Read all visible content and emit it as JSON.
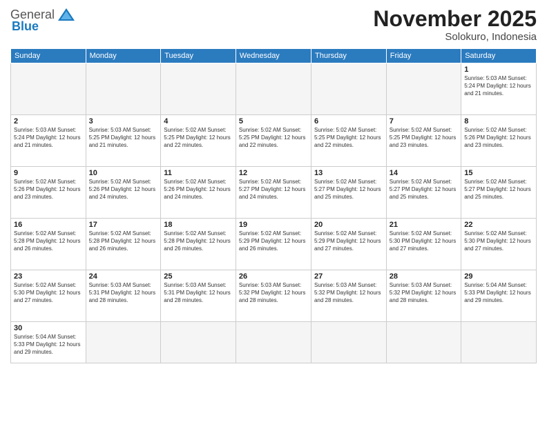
{
  "header": {
    "logo_general": "General",
    "logo_blue": "Blue",
    "month_year": "November 2025",
    "location": "Solokuro, Indonesia"
  },
  "weekdays": [
    "Sunday",
    "Monday",
    "Tuesday",
    "Wednesday",
    "Thursday",
    "Friday",
    "Saturday"
  ],
  "rows": [
    [
      {
        "date": "",
        "info": ""
      },
      {
        "date": "",
        "info": ""
      },
      {
        "date": "",
        "info": ""
      },
      {
        "date": "",
        "info": ""
      },
      {
        "date": "",
        "info": ""
      },
      {
        "date": "",
        "info": ""
      },
      {
        "date": "1",
        "info": "Sunrise: 5:03 AM\nSunset: 5:24 PM\nDaylight: 12 hours\nand 21 minutes."
      }
    ],
    [
      {
        "date": "2",
        "info": "Sunrise: 5:03 AM\nSunset: 5:24 PM\nDaylight: 12 hours\nand 21 minutes."
      },
      {
        "date": "3",
        "info": "Sunrise: 5:03 AM\nSunset: 5:25 PM\nDaylight: 12 hours\nand 21 minutes."
      },
      {
        "date": "4",
        "info": "Sunrise: 5:02 AM\nSunset: 5:25 PM\nDaylight: 12 hours\nand 22 minutes."
      },
      {
        "date": "5",
        "info": "Sunrise: 5:02 AM\nSunset: 5:25 PM\nDaylight: 12 hours\nand 22 minutes."
      },
      {
        "date": "6",
        "info": "Sunrise: 5:02 AM\nSunset: 5:25 PM\nDaylight: 12 hours\nand 22 minutes."
      },
      {
        "date": "7",
        "info": "Sunrise: 5:02 AM\nSunset: 5:25 PM\nDaylight: 12 hours\nand 23 minutes."
      },
      {
        "date": "8",
        "info": "Sunrise: 5:02 AM\nSunset: 5:26 PM\nDaylight: 12 hours\nand 23 minutes."
      }
    ],
    [
      {
        "date": "9",
        "info": "Sunrise: 5:02 AM\nSunset: 5:26 PM\nDaylight: 12 hours\nand 23 minutes."
      },
      {
        "date": "10",
        "info": "Sunrise: 5:02 AM\nSunset: 5:26 PM\nDaylight: 12 hours\nand 24 minutes."
      },
      {
        "date": "11",
        "info": "Sunrise: 5:02 AM\nSunset: 5:26 PM\nDaylight: 12 hours\nand 24 minutes."
      },
      {
        "date": "12",
        "info": "Sunrise: 5:02 AM\nSunset: 5:27 PM\nDaylight: 12 hours\nand 24 minutes."
      },
      {
        "date": "13",
        "info": "Sunrise: 5:02 AM\nSunset: 5:27 PM\nDaylight: 12 hours\nand 25 minutes."
      },
      {
        "date": "14",
        "info": "Sunrise: 5:02 AM\nSunset: 5:27 PM\nDaylight: 12 hours\nand 25 minutes."
      },
      {
        "date": "15",
        "info": "Sunrise: 5:02 AM\nSunset: 5:27 PM\nDaylight: 12 hours\nand 25 minutes."
      }
    ],
    [
      {
        "date": "16",
        "info": "Sunrise: 5:02 AM\nSunset: 5:28 PM\nDaylight: 12 hours\nand 26 minutes."
      },
      {
        "date": "17",
        "info": "Sunrise: 5:02 AM\nSunset: 5:28 PM\nDaylight: 12 hours\nand 26 minutes."
      },
      {
        "date": "18",
        "info": "Sunrise: 5:02 AM\nSunset: 5:28 PM\nDaylight: 12 hours\nand 26 minutes."
      },
      {
        "date": "19",
        "info": "Sunrise: 5:02 AM\nSunset: 5:29 PM\nDaylight: 12 hours\nand 26 minutes."
      },
      {
        "date": "20",
        "info": "Sunrise: 5:02 AM\nSunset: 5:29 PM\nDaylight: 12 hours\nand 27 minutes."
      },
      {
        "date": "21",
        "info": "Sunrise: 5:02 AM\nSunset: 5:30 PM\nDaylight: 12 hours\nand 27 minutes."
      },
      {
        "date": "22",
        "info": "Sunrise: 5:02 AM\nSunset: 5:30 PM\nDaylight: 12 hours\nand 27 minutes."
      }
    ],
    [
      {
        "date": "23",
        "info": "Sunrise: 5:02 AM\nSunset: 5:30 PM\nDaylight: 12 hours\nand 27 minutes."
      },
      {
        "date": "24",
        "info": "Sunrise: 5:03 AM\nSunset: 5:31 PM\nDaylight: 12 hours\nand 28 minutes."
      },
      {
        "date": "25",
        "info": "Sunrise: 5:03 AM\nSunset: 5:31 PM\nDaylight: 12 hours\nand 28 minutes."
      },
      {
        "date": "26",
        "info": "Sunrise: 5:03 AM\nSunset: 5:32 PM\nDaylight: 12 hours\nand 28 minutes."
      },
      {
        "date": "27",
        "info": "Sunrise: 5:03 AM\nSunset: 5:32 PM\nDaylight: 12 hours\nand 28 minutes."
      },
      {
        "date": "28",
        "info": "Sunrise: 5:03 AM\nSunset: 5:32 PM\nDaylight: 12 hours\nand 28 minutes."
      },
      {
        "date": "29",
        "info": "Sunrise: 5:04 AM\nSunset: 5:33 PM\nDaylight: 12 hours\nand 29 minutes."
      }
    ],
    [
      {
        "date": "30",
        "info": "Sunrise: 5:04 AM\nSunset: 5:33 PM\nDaylight: 12 hours\nand 29 minutes."
      },
      {
        "date": "",
        "info": ""
      },
      {
        "date": "",
        "info": ""
      },
      {
        "date": "",
        "info": ""
      },
      {
        "date": "",
        "info": ""
      },
      {
        "date": "",
        "info": ""
      },
      {
        "date": "",
        "info": ""
      }
    ]
  ]
}
